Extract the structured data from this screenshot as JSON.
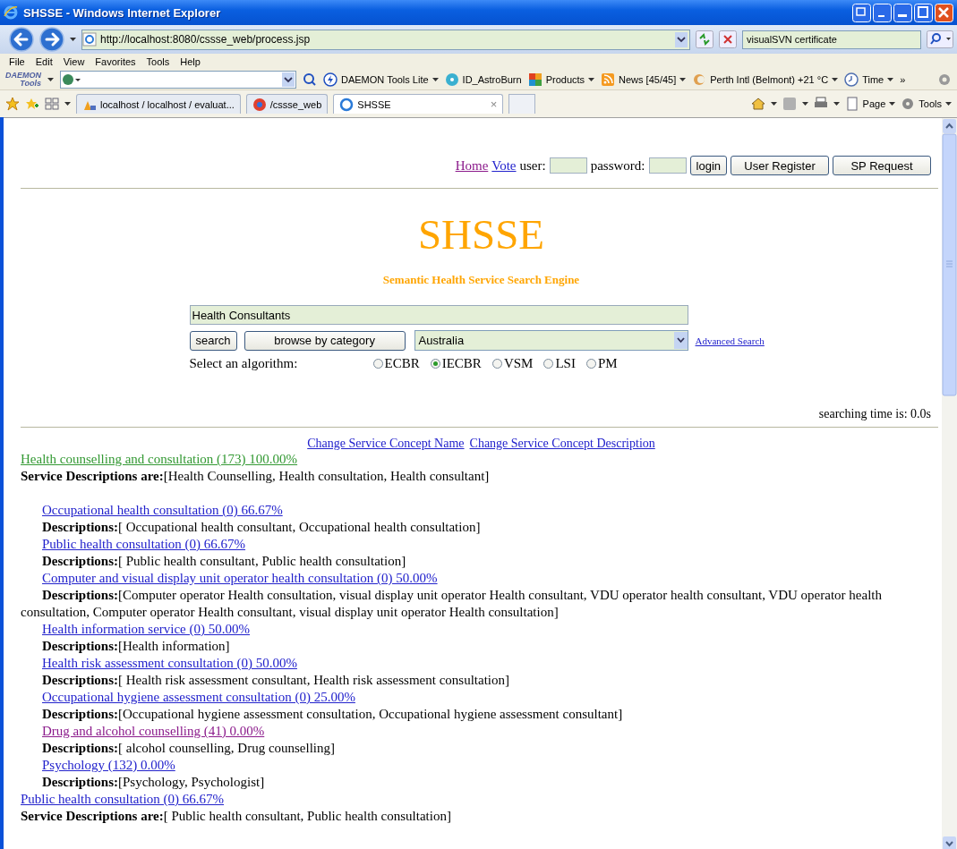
{
  "window": {
    "title": "SHSSE - Windows Internet Explorer"
  },
  "address_bar": {
    "url": "http://localhost:8080/cssse_web/process.jsp"
  },
  "search_box": {
    "value": "visualSVN certificate"
  },
  "menu": [
    "File",
    "Edit",
    "View",
    "Favorites",
    "Tools",
    "Help"
  ],
  "toolbar": {
    "logo": [
      "DAEMON",
      "Tools"
    ],
    "items": [
      {
        "label": "DAEMON Tools Lite",
        "dropdown": true
      },
      {
        "label": "ID_AstroBurn",
        "dropdown": false
      },
      {
        "label": "Products",
        "dropdown": true
      },
      {
        "label": "News [45/45]",
        "dropdown": true
      },
      {
        "label": "Perth Intl (Belmont) +21 °C",
        "dropdown": true
      },
      {
        "label": "Time",
        "dropdown": true
      }
    ],
    "more": "»"
  },
  "tabs": [
    {
      "label": "localhost / localhost / evaluat...",
      "selected": false
    },
    {
      "label": "/cssse_web",
      "selected": false
    },
    {
      "label": "SHSSE",
      "selected": true,
      "close": "×"
    }
  ],
  "command_bar": [
    "Page",
    "Tools"
  ],
  "page": {
    "nav_links": [
      {
        "label": "Home",
        "visited": true
      },
      {
        "label": "Vote",
        "visited": false
      }
    ],
    "user_label": "user:",
    "password_label": "password:",
    "login_buttons": [
      "login",
      "User Register",
      "SP Request"
    ],
    "title": "SHSSE",
    "subtitle": "Semantic Health Service Search Engine",
    "query": "Health Consultants",
    "search_buttons": [
      "search",
      "browse by category"
    ],
    "region": "Australia",
    "advanced_link": "Advanced Search",
    "algorithm_label": "Select an algorithm:",
    "algorithms": [
      {
        "label": "ECBR",
        "selected": false
      },
      {
        "label": "IECBR",
        "selected": true
      },
      {
        "label": "VSM",
        "selected": false
      },
      {
        "label": "LSI",
        "selected": false
      },
      {
        "label": "PM",
        "selected": false
      }
    ],
    "searching_time": "searching time is: 0.0s",
    "change_links": [
      "Change Service Concept Name",
      "Change Service Concept Description"
    ],
    "results": [
      {
        "concept": "Health counselling and consultation (173) 100.00%",
        "color": "#339933",
        "description": "**Service Descriptions are:**[Health Counselling, Health consultation, Health consultant]",
        "children": [
          {
            "concept": "Occupational health consultation (0) 66.67%",
            "color": "#2222cc",
            "description": "**Descriptions:**[ Occupational health consultant, Occupational health consultation]"
          },
          {
            "concept": "Public health consultation (0) 66.67%",
            "color": "#2222cc",
            "description": "**Descriptions:**[ Public health consultant, Public health consultation]"
          },
          {
            "concept": "Computer and visual display unit operator health consultation (0) 50.00%",
            "color": "#2222cc",
            "description": "**Descriptions:**[Computer operator Health consultation, visual display unit operator Health consultant, VDU operator health consultant, VDU operator health consultation, Computer operator Health consultant, visual display unit operator Health consultation]"
          },
          {
            "concept": "Health information service (0) 50.00%",
            "color": "#2222cc",
            "description": "**Descriptions:**[Health information]"
          },
          {
            "concept": "Health risk assessment consultation (0) 50.00%",
            "color": "#2222cc",
            "description": "**Descriptions:**[ Health risk assessment consultant, Health risk assessment consultation]"
          },
          {
            "concept": "Occupational hygiene assessment consultation (0) 25.00%",
            "color": "#2222cc",
            "description": "**Descriptions:**[Occupational hygiene assessment consultation, Occupational hygiene assessment consultant]"
          },
          {
            "concept": "Drug and alcohol counselling (41) 0.00%",
            "color": "#8b1a8b",
            "description": "**Descriptions:**[ alcohol counselling, Drug counselling]"
          },
          {
            "concept": "Psychology (132) 0.00%",
            "color": "#2222cc",
            "description": "**Descriptions:**[Psychology, Psychologist]"
          }
        ]
      },
      {
        "concept": "Public health consultation (0) 66.67%",
        "color": "#2222cc",
        "description": "**Service Descriptions are:**[ Public health consultant, Public health consultation]"
      }
    ]
  }
}
